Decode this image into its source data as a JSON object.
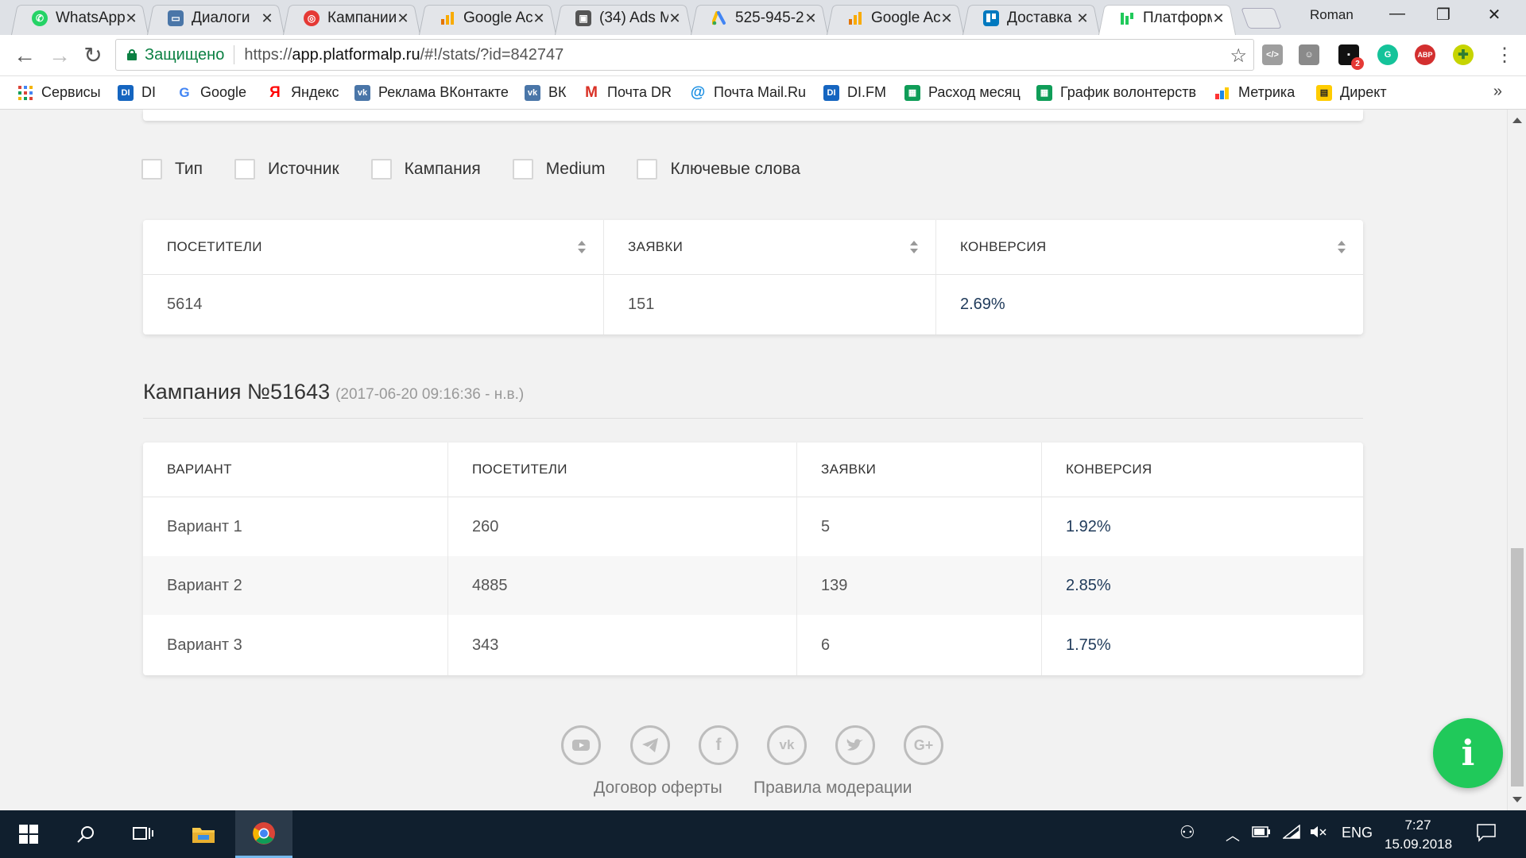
{
  "browser": {
    "tabs": [
      {
        "title": "WhatsApp",
        "icon": "whatsapp-icon",
        "color": "#25d366"
      },
      {
        "title": "Диалоги",
        "icon": "vk-dialogs-icon",
        "color": "#4a76a8"
      },
      {
        "title": "Кампании",
        "icon": "target-icon",
        "color": "#e53935"
      },
      {
        "title": "Google Ac",
        "icon": "analytics-icon",
        "color": "#f4a300"
      },
      {
        "title": "(34) Ads M",
        "icon": "ads-manager-icon",
        "color": "#555555"
      },
      {
        "title": "525-945-2",
        "icon": "google-ads-icon",
        "color": "#4285f4"
      },
      {
        "title": "Google Ac",
        "icon": "analytics-icon",
        "color": "#f4a300"
      },
      {
        "title": "Доставка",
        "icon": "trello-icon",
        "color": "#0079bf"
      },
      {
        "title": "Платформ",
        "icon": "platformalp-icon",
        "color": "#20c95a"
      }
    ],
    "profile_name": "Roman",
    "omnibox": {
      "secure_label": "Защищено",
      "url_scheme": "https://",
      "url_host": "app.platformalp.ru",
      "url_path": "/#!/stats/?id=842747"
    },
    "extension_badge": "2",
    "extension_labels": {
      "abp": "ABP",
      "grammarly": "G"
    },
    "bookmarks": [
      {
        "label": "Сервисы",
        "icon": "apps-grid-icon",
        "color": "#db4437"
      },
      {
        "label": "DI",
        "icon": "di-icon",
        "color": "#1565c0"
      },
      {
        "label": "Google",
        "icon": "google-icon",
        "color": "#4285f4"
      },
      {
        "label": "Яндекс",
        "icon": "yandex-icon",
        "color": "#ff0000"
      },
      {
        "label": "Реклама ВКонтакте",
        "icon": "vk-icon",
        "color": "#4a76a8"
      },
      {
        "label": "ВК",
        "icon": "vk-icon",
        "color": "#4a76a8"
      },
      {
        "label": "Почта DR",
        "icon": "gmail-icon",
        "color": "#d93025"
      },
      {
        "label": "Почта Mail.Ru",
        "icon": "mailru-icon",
        "color": "#168de2"
      },
      {
        "label": "DI.FM",
        "icon": "di-icon",
        "color": "#1565c0"
      },
      {
        "label": "Расход месяц",
        "icon": "sheets-icon",
        "color": "#0f9d58"
      },
      {
        "label": "График волонтерств",
        "icon": "sheets-icon",
        "color": "#0f9d58"
      },
      {
        "label": "Метрика",
        "icon": "metrika-icon",
        "color": "#ff3333"
      },
      {
        "label": "Директ",
        "icon": "direct-icon",
        "color": "#ffcc00"
      }
    ],
    "bookmarks_more": "»"
  },
  "filters": [
    "Тип",
    "Источник",
    "Кампания",
    "Medium",
    "Ключевые слова"
  ],
  "summary_table": {
    "columns": [
      "ПОСЕТИТЕЛИ",
      "ЗАЯВКИ",
      "КОНВЕРСИЯ"
    ],
    "row": [
      "5614",
      "151",
      "2.69%"
    ]
  },
  "campaign": {
    "title": "Кампания №51643",
    "dates": "(2017-06-20 09:16:36 - н.в.)"
  },
  "variants_table": {
    "columns": [
      "ВАРИАНТ",
      "ПОСЕТИТЕЛИ",
      "ЗАЯВКИ",
      "КОНВЕРСИЯ"
    ],
    "rows": [
      [
        "Вариант 1",
        "260",
        "5",
        "1.92%"
      ],
      [
        "Вариант 2",
        "4885",
        "139",
        "2.85%"
      ],
      [
        "Вариант 3",
        "343",
        "6",
        "1.75%"
      ]
    ]
  },
  "footer": {
    "social": [
      "youtube-icon",
      "telegram-icon",
      "facebook-icon",
      "vk-icon",
      "twitter-icon",
      "google-plus-icon"
    ],
    "links": [
      "Договор оферты",
      "Правила модерации"
    ]
  },
  "info_button_label": "i",
  "taskbar": {
    "language": "ENG",
    "time": "7:27",
    "date": "15.09.2018"
  },
  "colors": {
    "accent_green": "#20c95a",
    "conversion_text": "#1f3a5a",
    "taskbar_bg": "#101f2e"
  }
}
